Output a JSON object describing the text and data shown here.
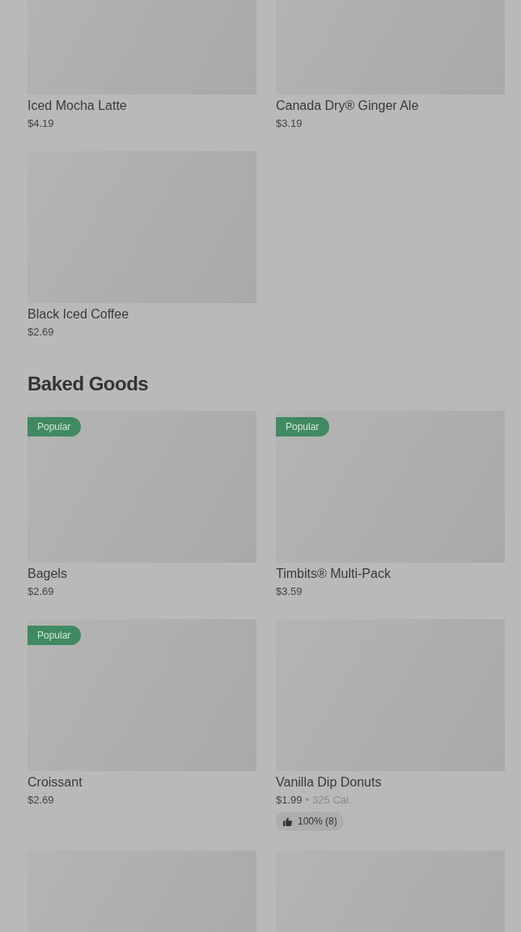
{
  "sections": [
    {
      "items": [
        {
          "kind": "product",
          "name": "Iced Mocha Latte",
          "price": "$4.19"
        },
        {
          "kind": "product",
          "name": "Canada Dry® Ginger Ale",
          "price": "$3.19"
        },
        {
          "kind": "product",
          "name": "Black Iced Coffee",
          "price": "$2.69"
        }
      ]
    },
    {
      "title": "Baked Goods",
      "items": [
        {
          "kind": "product",
          "name": "Bagels",
          "price": "$2.69",
          "badge": "Popular"
        },
        {
          "kind": "product",
          "name": "Timbits® Multi-Pack",
          "price": "$3.59",
          "badge": "Popular"
        },
        {
          "kind": "product",
          "name": "Croissant",
          "price": "$2.69",
          "badge": "Popular"
        },
        {
          "kind": "product",
          "name": "Vanilla Dip Donuts",
          "price": "$1.99",
          "separator": "•",
          "calories": "325 Cal.",
          "rating": "100% (8)"
        },
        {
          "kind": "picture"
        },
        {
          "kind": "picture"
        }
      ]
    }
  ]
}
